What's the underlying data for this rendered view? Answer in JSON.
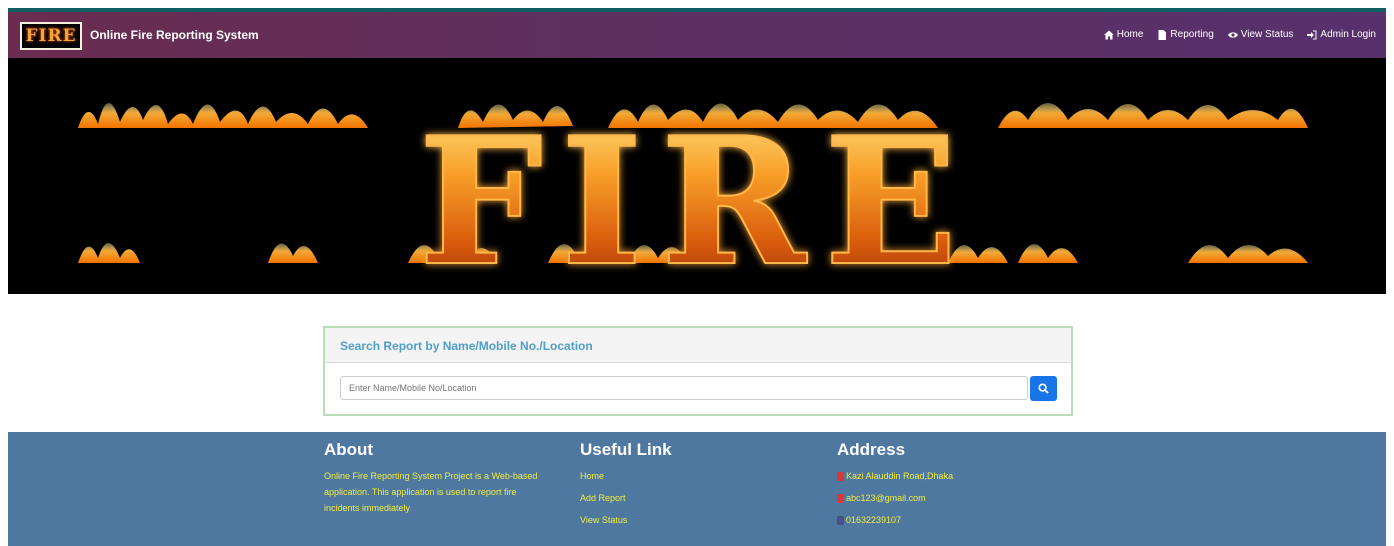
{
  "navbar": {
    "logo_text": "FIRE",
    "title": "Online Fire Reporting System",
    "links": [
      {
        "label": "Home",
        "icon": "home-icon"
      },
      {
        "label": "Reporting",
        "icon": "file-icon"
      },
      {
        "label": "View Status",
        "icon": "eye-icon"
      },
      {
        "label": "Admin Login",
        "icon": "sign-in-icon"
      }
    ]
  },
  "hero": {
    "text": "FIRE"
  },
  "search": {
    "title": "Search Report by Name/Mobile No./Location",
    "placeholder": "Enter Name/Mobile No/Location",
    "button_icon": "search-icon"
  },
  "footer": {
    "about": {
      "heading": "About",
      "text": "Online Fire Reporting System Project is a Web-based application. This application is used to report fire incidents immediately"
    },
    "useful_links": {
      "heading": "Useful Link",
      "links": [
        "Home",
        "Add Report",
        "View Status"
      ]
    },
    "address": {
      "heading": "Address",
      "items": [
        "Kazi Alauddin Road,Dhaka",
        "abc123@gmail.com",
        "01632239107"
      ]
    }
  },
  "colors": {
    "navbar": "#5e3060",
    "footer": "#4f78a1",
    "footer_text": "#f2ec3b",
    "search_title": "#4f9fc9",
    "search_button": "#1875e8"
  }
}
